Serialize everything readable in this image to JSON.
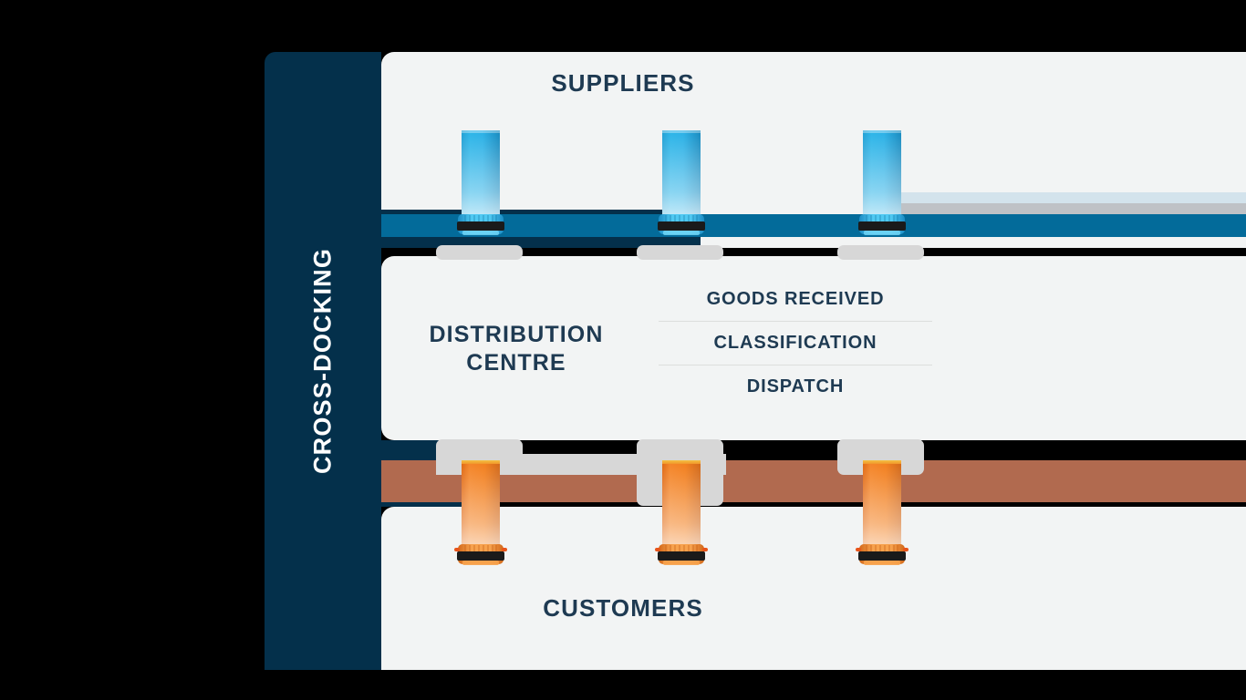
{
  "diagram": {
    "sidebar_label": "CROSS-DOCKING",
    "colors": {
      "navy": "#04304b",
      "panel": "#f2f4f4",
      "text_navy": "#1e3a52",
      "inbound_band": "#036b9a",
      "outbound_band": "#b16a4f",
      "bay_grey": "#d7d7d7",
      "truck_blue": "#29b6e8",
      "truck_orange": "#f08020"
    },
    "sections": {
      "suppliers": {
        "title": "SUPPLIERS",
        "trucks": [
          {
            "name": "supplier-truck-1",
            "color": "blue"
          },
          {
            "name": "supplier-truck-2",
            "color": "blue"
          },
          {
            "name": "supplier-truck-3",
            "color": "blue"
          }
        ],
        "bays": [
          "bay-1",
          "bay-2",
          "bay-3"
        ]
      },
      "distribution_centre": {
        "title": "DISTRIBUTION CENTRE",
        "stages": [
          "GOODS RECEIVED",
          "CLASSIFICATION",
          "DISPATCH"
        ]
      },
      "customers": {
        "title": "CUSTOMERS",
        "trucks": [
          {
            "name": "customer-truck-1",
            "color": "orange"
          },
          {
            "name": "customer-truck-2",
            "color": "orange"
          },
          {
            "name": "customer-truck-3",
            "color": "orange"
          }
        ],
        "bays": [
          "bay-1",
          "bay-2",
          "bay-3"
        ]
      }
    }
  }
}
